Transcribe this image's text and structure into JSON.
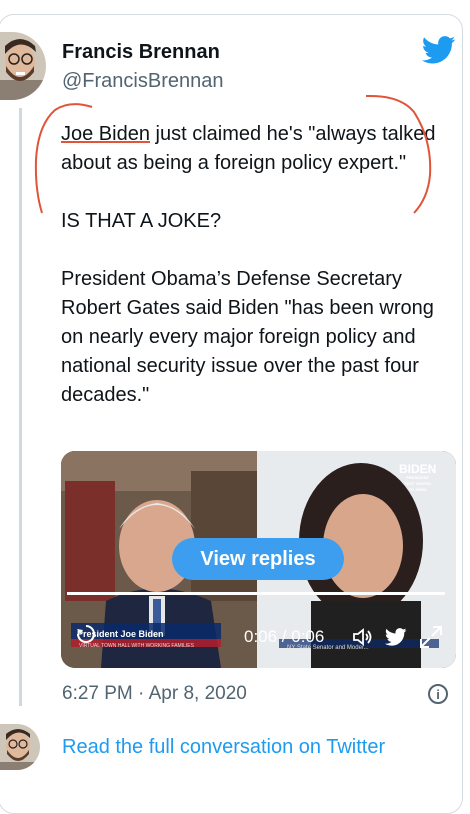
{
  "author": {
    "name": "Francis Brennan",
    "handle": "@FrancisBrennan"
  },
  "tweet": {
    "mention": "Joe Biden",
    "text_rest": " just claimed he's \"always talked about as being a foreign policy expert.\"\n\nIS THAT A JOKE?\n\nPresident Obama’s Defense Secretary Robert Gates said Biden \"has been wrong on nearly every major foreign policy and national security issue over the past four decades.\""
  },
  "media": {
    "view_replies_label": "View replies",
    "time_display": "0:06 / 0:06",
    "lower_third": "President Joe Biden",
    "lower_third_sub": "VIRTUAL TOWN HALL WITH WORKING FAMILIES",
    "right_caption": "NY State Senator and Moder...",
    "brand": "BIDEN",
    "brand_sub1": "PRESIDENT",
    "brand_sub2": "TEXT UNITED",
    "brand_sub3": "TO 30330",
    "progress_fraction": 1.0
  },
  "timestamp": "6:27 PM · Apr 8, 2020",
  "read_link": "Read the full conversation on Twitter",
  "colors": {
    "link": "#1d9bf0",
    "annotation": "#e0553a",
    "view_replies_bg": "#3d9ef0"
  },
  "icons": [
    "twitter-bird-icon",
    "info-icon",
    "replay-icon",
    "volume-icon",
    "fullscreen-icon"
  ]
}
